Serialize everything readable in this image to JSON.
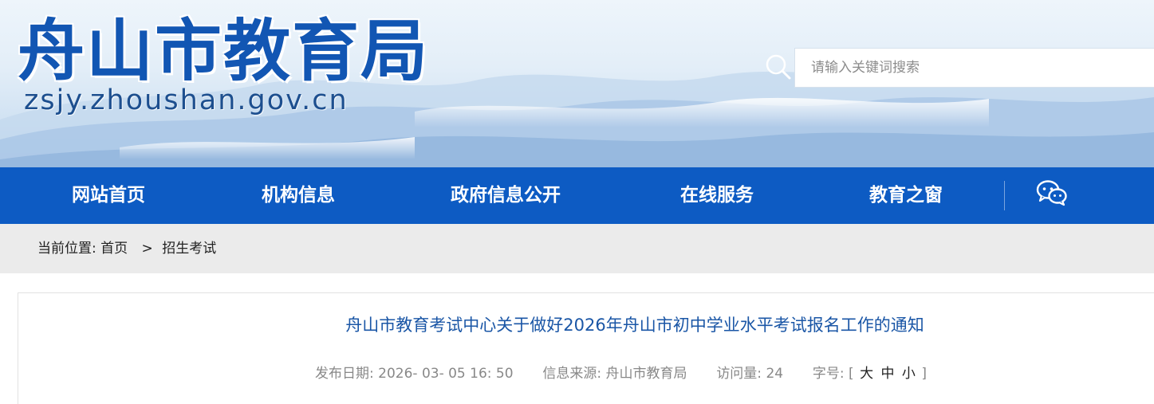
{
  "header": {
    "site_title": "舟山市教育局",
    "site_domain": "zsjy.zhoushan.gov.cn",
    "search_placeholder": "请输入关键词搜索",
    "search_icon": "search-icon"
  },
  "nav": {
    "items": [
      {
        "label": "网站首页"
      },
      {
        "label": "机构信息"
      },
      {
        "label": "政府信息公开"
      },
      {
        "label": "在线服务"
      },
      {
        "label": "教育之窗"
      }
    ],
    "wechat_icon": "wechat-icon"
  },
  "breadcrumb": {
    "prefix": "当前位置:",
    "home": "首页",
    "separator": ">",
    "current": "招生考试"
  },
  "article": {
    "title": "舟山市教育考试中心关于做好2026年舟山市初中学业水平考试报名工作的通知",
    "publish_date_label": "发布日期:",
    "publish_date": "2026- 03- 05 16: 50",
    "source_label": "信息来源:",
    "source": "舟山市教育局",
    "views_label": "访问量:",
    "views": "24",
    "font_size_label": "字号:",
    "font_size_open": "[",
    "font_size_large": "大",
    "font_size_medium": "中",
    "font_size_small": "小",
    "font_size_close": "]"
  },
  "colors": {
    "brand_blue": "#1256b3",
    "nav_blue": "#0d5bc3",
    "title_blue": "#1a56a6",
    "breadcrumb_bg": "#ebebeb"
  }
}
